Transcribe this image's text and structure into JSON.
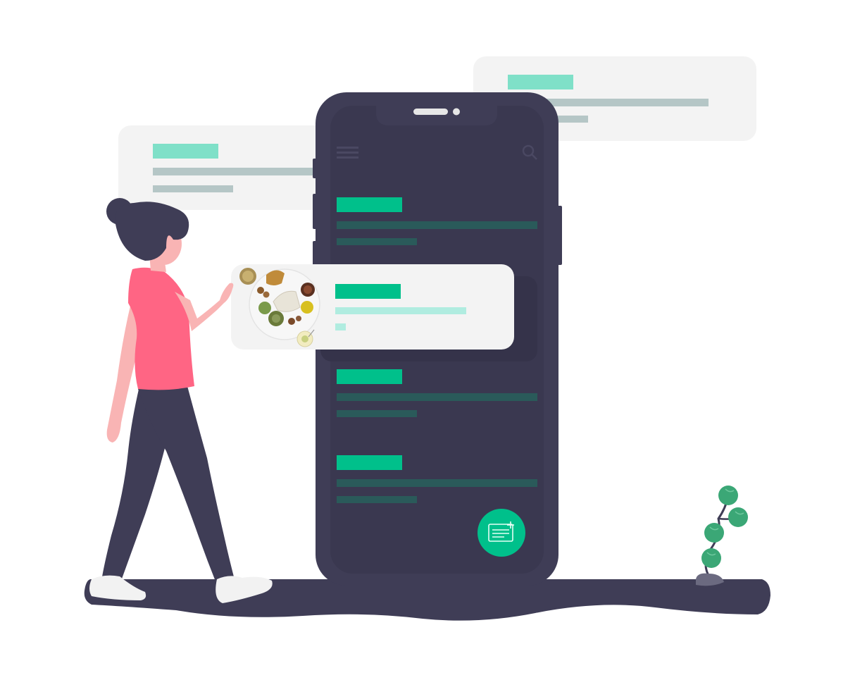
{
  "illustration": {
    "subject": "woman-with-phone-food-app",
    "colors": {
      "accent": "#00c08b",
      "accent_light": "#7fe0c8",
      "accent_pale": "#b0ece0",
      "phone_body": "#3f3d56",
      "phone_screen": "#3a3850",
      "screen_line": "#2a5a5a",
      "card_bg": "#f3f3f3",
      "card_line": "#b5c6c6",
      "shirt": "#ff6584",
      "skin": "#f9b4b4",
      "hair": "#3f3d56",
      "shoe": "#f2f2f2",
      "ground": "#3f3d56",
      "leaf": "#3ba776"
    },
    "icons": [
      "hamburger-menu-icon",
      "search-icon",
      "add-note-icon",
      "food-plate-icon"
    ],
    "screen_list_items": 4,
    "background_cards": 2
  }
}
